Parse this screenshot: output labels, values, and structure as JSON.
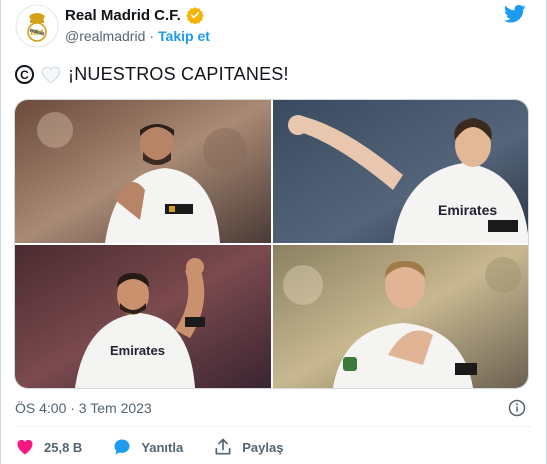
{
  "author": {
    "name": "Real Madrid C.F.",
    "handle": "@realmadrid",
    "separator": "·",
    "follow_label": "Takip et",
    "verified_color": "#f4b400"
  },
  "tweet": {
    "copyright_symbol": "C",
    "text": "¡NUESTROS CAPITANES!",
    "timestamp": "ÖS 4:00 · 3 Tem 2023"
  },
  "photos": [
    {
      "alt": "Player applauding in white kit with captain armband",
      "jersey_text": ""
    },
    {
      "alt": "Player celebrating with arm raised, Emirates shirt",
      "jersey_text": "Emirates"
    },
    {
      "alt": "Player raising fist, Emirates FLY BETTER shirt",
      "jersey_text": "Emirates"
    },
    {
      "alt": "Player applauding with captain armband",
      "jersey_text": ""
    }
  ],
  "actions": {
    "like_count": "25,8 B",
    "reply_label": "Yanıtla",
    "share_label": "Paylaş"
  },
  "colors": {
    "accent": "#1d9bf0",
    "like": "#f91880",
    "text": "#0f1419",
    "muted": "#536471"
  }
}
